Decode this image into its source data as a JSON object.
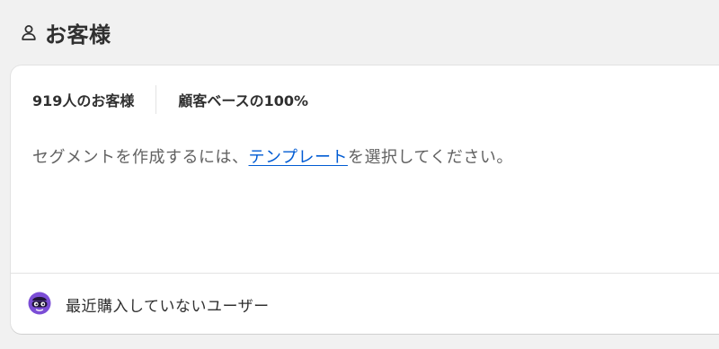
{
  "header": {
    "icon": "person-icon",
    "title": "お客様"
  },
  "stats": {
    "customer_count": "919人のお客様",
    "customer_base": "顧客ベースの100%"
  },
  "hint": {
    "prefix": "セグメントを作成するには、",
    "link": "テンプレート",
    "suffix": "を選択してください。"
  },
  "suggestion": {
    "icon": "mascot-avatar-icon",
    "label": "最近購入していないユーザー"
  },
  "colors": {
    "background": "#f1f1f1",
    "card": "#ffffff",
    "link": "#005bd3",
    "avatar": "#7b4dd6"
  }
}
